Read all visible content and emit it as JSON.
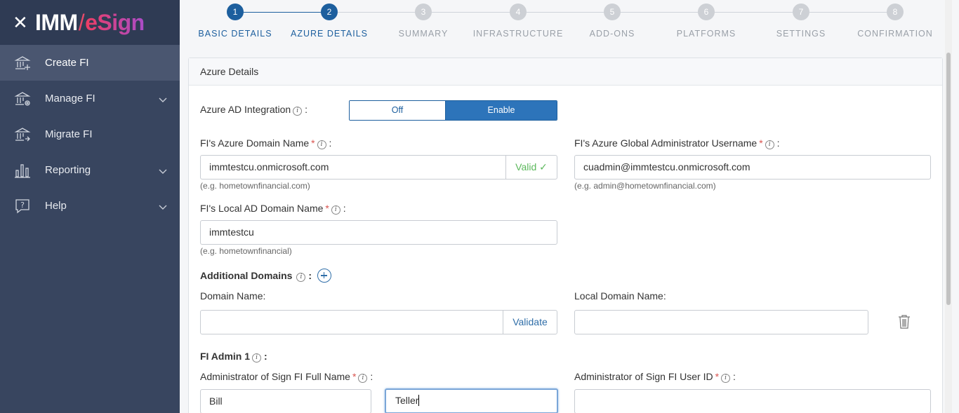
{
  "brand": {
    "imm": "IMM",
    "slash": "/",
    "esign": "eSign"
  },
  "sidebar": {
    "items": [
      {
        "label": "Create FI",
        "icon": "bank-add-icon",
        "active": true,
        "expandable": false
      },
      {
        "label": "Manage FI",
        "icon": "bank-settings-icon",
        "active": false,
        "expandable": true
      },
      {
        "label": "Migrate FI",
        "icon": "bank-migrate-icon",
        "active": false,
        "expandable": false
      },
      {
        "label": "Reporting",
        "icon": "bar-chart-icon",
        "active": false,
        "expandable": true
      },
      {
        "label": "Help",
        "icon": "help-icon",
        "active": false,
        "expandable": true
      }
    ]
  },
  "stepper": {
    "steps": [
      {
        "num": "1",
        "label": "BASIC DETAILS",
        "state": "done"
      },
      {
        "num": "2",
        "label": "AZURE DETAILS",
        "state": "current"
      },
      {
        "num": "3",
        "label": "SUMMARY",
        "state": "pending"
      },
      {
        "num": "4",
        "label": "INFRASTRUCTURE",
        "state": "pending"
      },
      {
        "num": "5",
        "label": "ADD-ONS",
        "state": "pending"
      },
      {
        "num": "6",
        "label": "PLATFORMS",
        "state": "pending"
      },
      {
        "num": "7",
        "label": "SETTINGS",
        "state": "pending"
      },
      {
        "num": "8",
        "label": "CONFIRMATION",
        "state": "pending"
      }
    ]
  },
  "card": {
    "title": "Azure Details",
    "azure_ad": {
      "label": "Azure AD Integration",
      "colon": ":",
      "off": "Off",
      "on": "Enable",
      "selected": "Enable"
    },
    "azure_domain": {
      "label": "FI's Azure Domain Name",
      "req": "*",
      "colon": ":",
      "value": "immtestcu.onmicrosoft.com",
      "status": "Valid ✓",
      "hint": "(e.g. hometownfinancial.com)"
    },
    "admin_username": {
      "label": "FI's Azure Global Administrator Username",
      "req": "*",
      "colon": ":",
      "value": "cuadmin@immtestcu.onmicrosoft.com",
      "hint": "(e.g. admin@hometownfinancial.com)"
    },
    "local_ad": {
      "label": "FI's Local AD Domain Name",
      "req": "*",
      "colon": ":",
      "value": "immtestcu",
      "hint": "(e.g. hometownfinancial)"
    },
    "additional": {
      "title": "Additional Domains",
      "colon": ":",
      "domain_label": "Domain Name:",
      "domain_value": "",
      "validate": "Validate",
      "local_label": "Local Domain Name:",
      "local_value": ""
    },
    "admin1": {
      "title": "FI Admin 1",
      "colon": ":",
      "fullname_label": "Administrator of Sign FI Full Name",
      "userid_label": "Administrator of Sign FI User ID",
      "req": "*",
      "first": "Bill",
      "last": "Teller",
      "userid": ""
    },
    "info_glyph": "i"
  },
  "colors": {
    "primary": "#1d5f9e",
    "sidebar": "#38455f",
    "valid": "#5cb85c",
    "required": "#d9534f"
  }
}
